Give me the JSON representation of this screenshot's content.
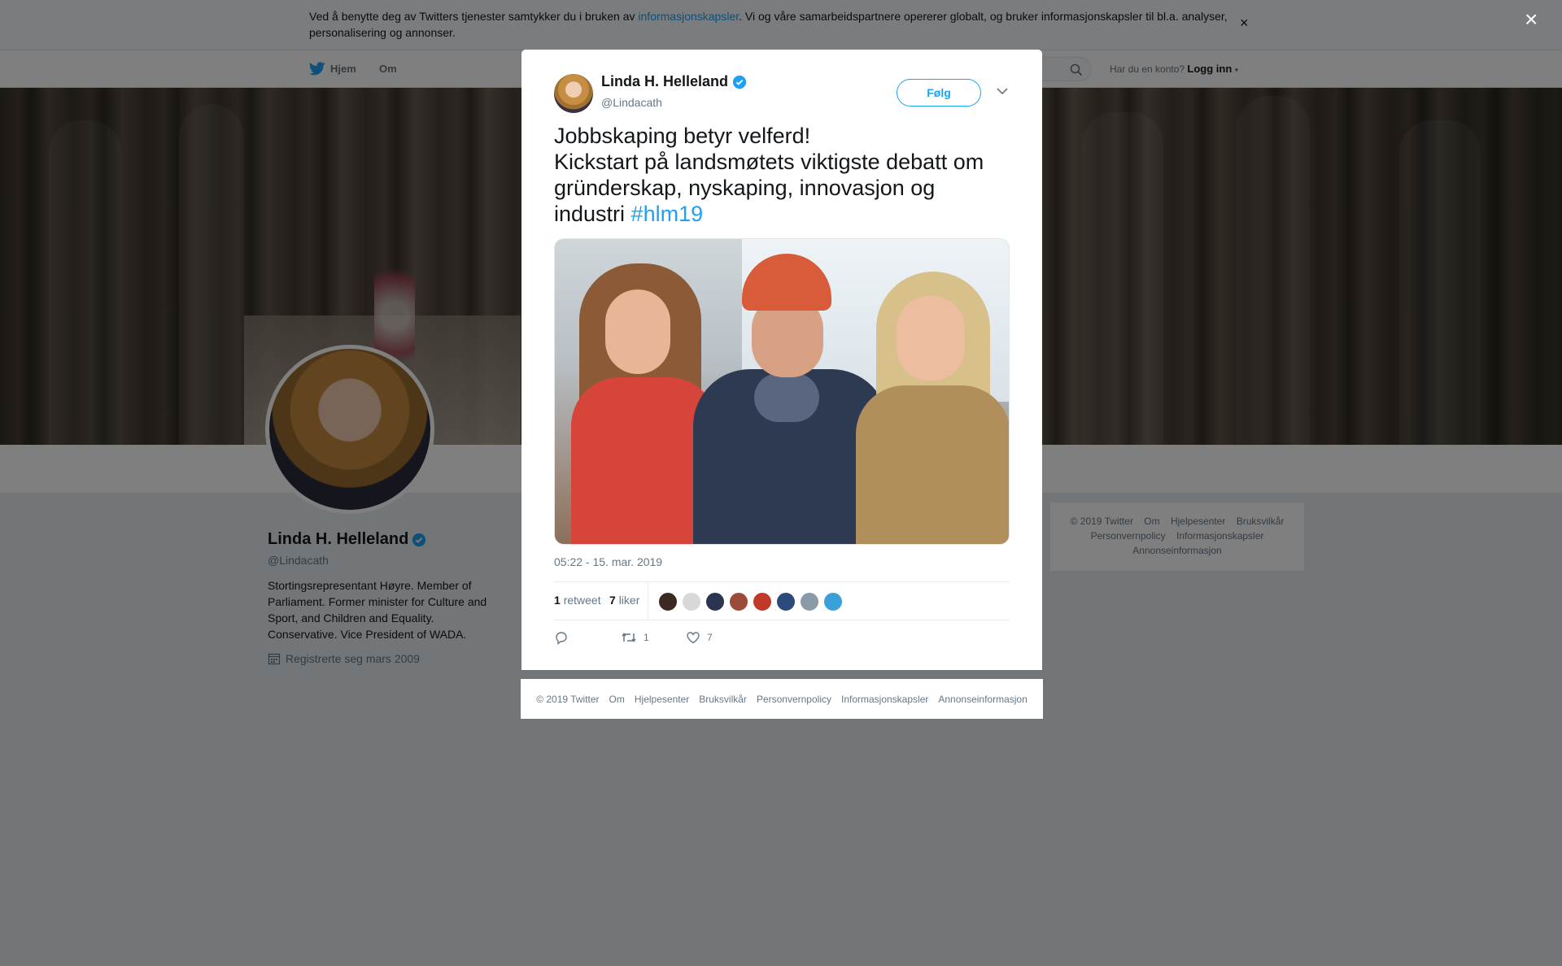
{
  "cookie_banner": {
    "text_before": "Ved å benytte deg av Twitters tjenester samtykker du i bruken av ",
    "link": "informasjonskapsler",
    "text_after": ". Vi og våre samarbeidspartnere opererer globalt, og bruker informasjonskapsler til bl.a. analyser, personalisering og annonser.",
    "close": "×"
  },
  "nav": {
    "home": "Hjem",
    "about": "Om",
    "account_prompt": "Har du en konto?",
    "login": "Logg inn"
  },
  "profile": {
    "name": "Linda H. Helleland",
    "handle": "@Lindacath",
    "bio": "Stortingsrepresentant Høyre. Member of Parliament. Former minister for Culture and Sport, and Children and Equality. Conservative. Vice President of WADA.",
    "joined": "Registrerte seg mars 2009"
  },
  "right_footer": {
    "links": [
      "© 2019 Twitter",
      "Om",
      "Hjelpesenter",
      "Bruksvilkår",
      "Personvernpolicy",
      "Informasjonskapsler",
      "Annonseinformasjon"
    ]
  },
  "overlay": {
    "close": "×"
  },
  "tweet": {
    "author_name": "Linda H. Helleland",
    "author_handle": "@Lindacath",
    "follow_label": "Følg",
    "text_line1": "Jobbskaping betyr velferd!",
    "text_line2": "Kickstart på landsmøtets viktigste debatt om gründerskap, nyskaping, innovasjon og industri ",
    "hashtag": "#hlm19",
    "timestamp": "05:22 - 15. mar. 2019",
    "retweet_count": "1",
    "retweet_label": "retweet",
    "like_count": "7",
    "like_label": "liker",
    "action_retweet_count": "1",
    "action_like_count": "7",
    "liker_avatar_colors": [
      "#3b2a22",
      "#d8d8d8",
      "#2a3550",
      "#9c4a3a",
      "#c0392b",
      "#2c4a7a",
      "#8a9aa6",
      "#3aa0d8"
    ]
  },
  "modal_footer": {
    "links": [
      "© 2019 Twitter",
      "Om",
      "Hjelpesenter",
      "Bruksvilkår",
      "Personvernpolicy",
      "Informasjonskapsler",
      "Annonseinformasjon"
    ]
  },
  "colors": {
    "accent": "#1da1f2",
    "verified": "#1da1f2",
    "overlay": "rgba(0,0,0,0.5)"
  }
}
